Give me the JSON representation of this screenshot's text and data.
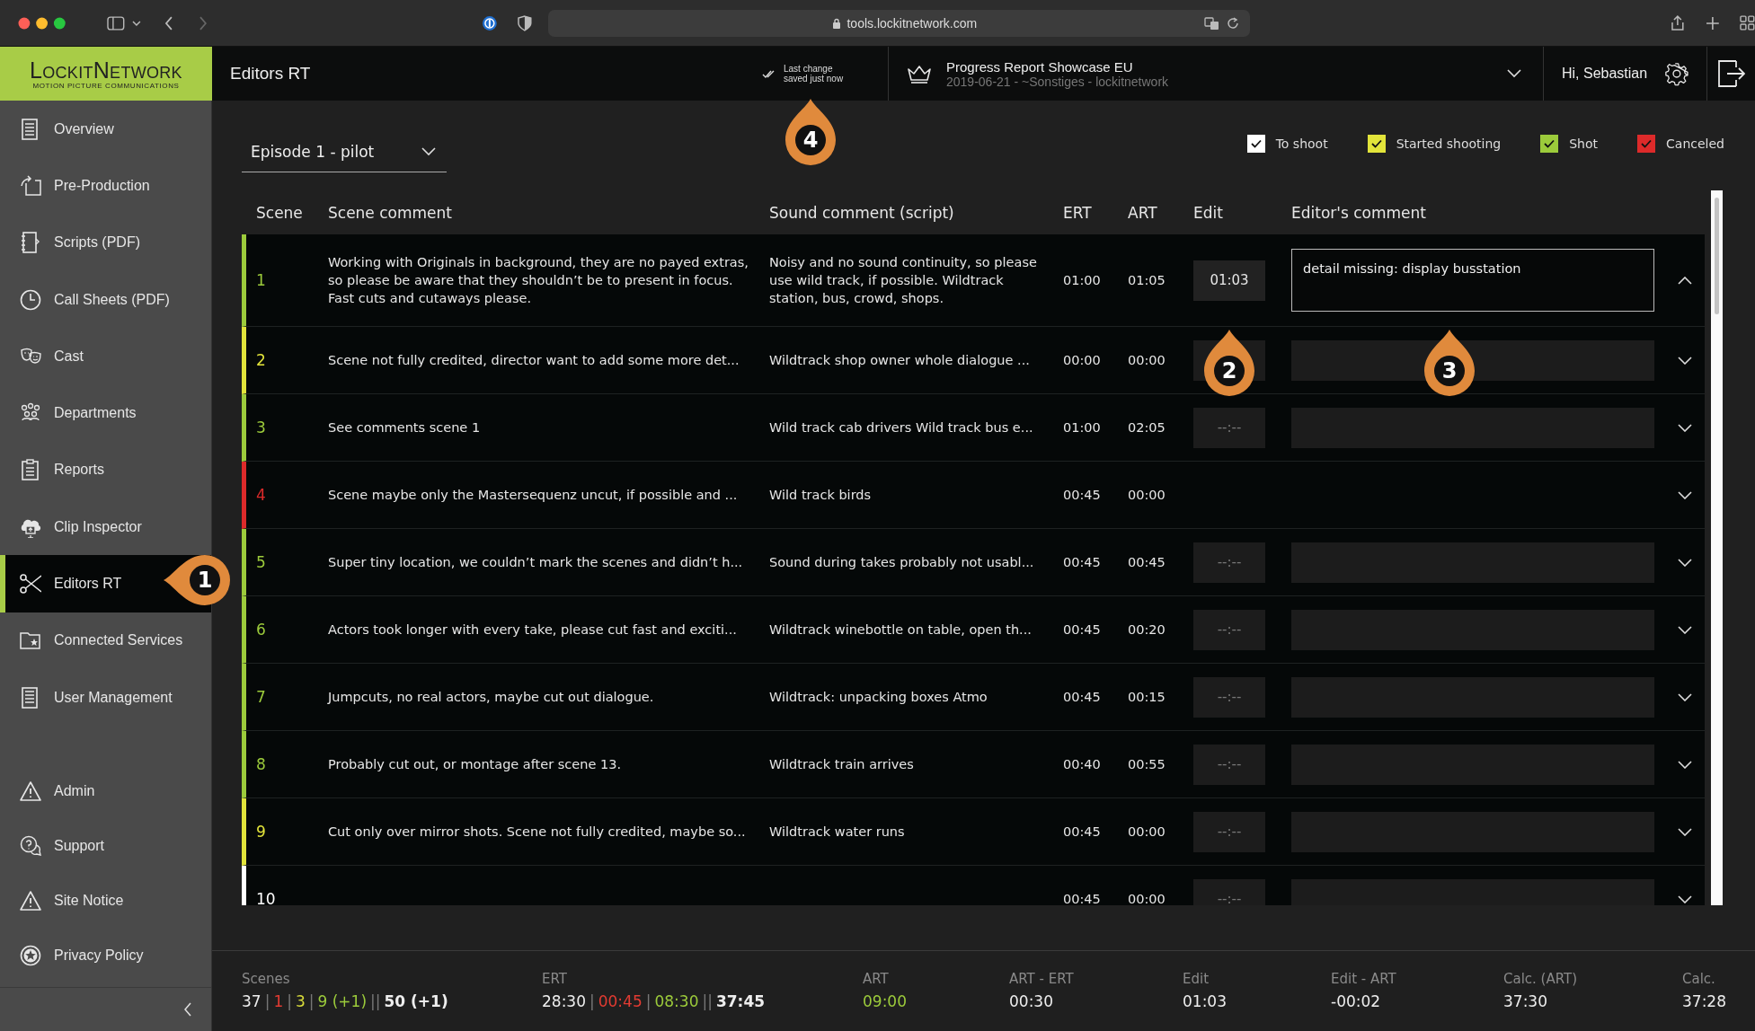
{
  "browser": {
    "url": "tools.lockitnetwork.com"
  },
  "logo": {
    "name": "LockitNetwork",
    "tagline": "MOTION PICTURE COMMUNICATIONS"
  },
  "header": {
    "title": "Editors RT",
    "save_status": [
      "Last change",
      "saved just now"
    ],
    "project": {
      "title": "Progress Report Showcase EU",
      "subtitle": "2019-06-21 - ~Sonstiges - lockitnetwork"
    },
    "greeting": "Hi, Sebastian"
  },
  "sidebar": {
    "items": [
      {
        "label": "Overview",
        "selected": false
      },
      {
        "label": "Pre-Production",
        "selected": false
      },
      {
        "label": "Scripts (PDF)",
        "selected": false
      },
      {
        "label": "Call Sheets (PDF)",
        "selected": false
      },
      {
        "label": "Cast",
        "selected": false
      },
      {
        "label": "Departments",
        "selected": false
      },
      {
        "label": "Reports",
        "selected": false
      },
      {
        "label": "Clip Inspector",
        "selected": false
      },
      {
        "label": "Editors RT",
        "selected": true
      },
      {
        "label": "Connected Services",
        "selected": false
      },
      {
        "label": "User Management",
        "selected": false
      }
    ],
    "footer_items": [
      {
        "label": "Admin",
        "selected": false
      },
      {
        "label": "Support",
        "selected": false
      },
      {
        "label": "Site Notice",
        "selected": false
      },
      {
        "label": "Privacy Policy",
        "selected": false
      }
    ]
  },
  "episode_select": {
    "value": "Episode 1 - pilot"
  },
  "legend": [
    {
      "label": "To shoot",
      "checked": true,
      "color": "#ffffff"
    },
    {
      "label": "Started shooting",
      "checked": true,
      "color": "#e2e43a"
    },
    {
      "label": "Shot",
      "checked": true,
      "color": "#9ccb3b"
    },
    {
      "label": "Canceled",
      "checked": true,
      "color": "#dd2a2a"
    }
  ],
  "table": {
    "columns": [
      "Scene",
      "Scene comment",
      "Sound comment (script)",
      "ERT",
      "ART",
      "Edit",
      "Editor's comment"
    ],
    "rows": [
      {
        "scene": "1",
        "color": "#9ccb3b",
        "scene_comment": "Working with Originals in background, they are no payed extras, so please be aware that they shouldn’t be to present in focus. Fast cuts and cutaways please.",
        "sound_comment": "Noisy and no sound continuity, so please use wild track, if possible. Wildtrack station, bus, crowd, shops.",
        "ert": "01:00",
        "art": "01:05",
        "edit": {
          "value": "01:03"
        },
        "editor_comment": {
          "value": "detail missing: display busstation",
          "focused": true
        },
        "expanded": true
      },
      {
        "scene": "2",
        "color": "#e2e43a",
        "scene_comment": "Scene not fully credited, director want to add some more det...",
        "sound_comment": "Wildtrack shop owner whole dialogue ...",
        "ert": "00:00",
        "art": "00:00",
        "edit": {},
        "editor_comment": {
          "focused": false
        },
        "expanded": false
      },
      {
        "scene": "3",
        "color": "#9ccb3b",
        "scene_comment": "See comments scene 1",
        "sound_comment": "Wild track cab drivers Wild track bus e...",
        "ert": "01:00",
        "art": "02:05",
        "edit": {
          "placeholder": "--:--"
        },
        "editor_comment": {
          "focused": false
        },
        "expanded": false
      },
      {
        "scene": "4",
        "color": "#dd2a2a",
        "scene_comment": "Scene maybe only the Mastersequenz uncut, if possible and ...",
        "sound_comment": "Wild track birds",
        "ert": "00:45",
        "art": "00:00",
        "expanded": false
      },
      {
        "scene": "5",
        "color": "#9ccb3b",
        "scene_comment": "Super tiny location, we couldn’t mark the scenes and didn’t h...",
        "sound_comment": "Sound during takes probably not usabl...",
        "ert": "00:45",
        "art": "00:45",
        "edit": {
          "placeholder": "--:--"
        },
        "editor_comment": {
          "focused": false
        },
        "expanded": false
      },
      {
        "scene": "6",
        "color": "#9ccb3b",
        "scene_comment": "Actors took longer with every take, please cut fast and exciti...",
        "sound_comment": "Wildtrack winebottle on table, open th...",
        "ert": "00:45",
        "art": "00:20",
        "edit": {
          "placeholder": "--:--"
        },
        "editor_comment": {
          "focused": false
        },
        "expanded": false
      },
      {
        "scene": "7",
        "color": "#9ccb3b",
        "scene_comment": "Jumpcuts, no real actors, maybe cut out dialogue.",
        "sound_comment": "Wildtrack: unpacking boxes Atmo",
        "ert": "00:45",
        "art": "00:15",
        "edit": {
          "placeholder": "--:--"
        },
        "editor_comment": {
          "focused": false
        },
        "expanded": false
      },
      {
        "scene": "8",
        "color": "#9ccb3b",
        "scene_comment": "Probably cut out, or montage after scene 13.",
        "sound_comment": "Wildtrack train arrives",
        "ert": "00:40",
        "art": "00:55",
        "edit": {
          "placeholder": "--:--"
        },
        "editor_comment": {
          "focused": false
        },
        "expanded": false
      },
      {
        "scene": "9",
        "color": "#e2e43a",
        "scene_comment": "Cut only over mirror shots. Scene not fully credited, maybe so...",
        "sound_comment": "Wildtrack water runs",
        "ert": "00:45",
        "art": "00:00",
        "edit": {
          "placeholder": "--:--"
        },
        "editor_comment": {
          "focused": false
        },
        "expanded": false
      },
      {
        "scene": "10",
        "color": "#ffffff",
        "ert": "00:45",
        "art": "00:00",
        "edit": {
          "placeholder": "--:--"
        },
        "editor_comment": {
          "focused": false
        },
        "expanded": false
      }
    ]
  },
  "summary": [
    {
      "label": "Scenes",
      "parts": [
        {
          "text": "37",
          "kind": "plain"
        },
        {
          "text": "|",
          "kind": "sep"
        },
        {
          "text": "1",
          "kind": "red"
        },
        {
          "text": "|",
          "kind": "sep"
        },
        {
          "text": "3",
          "kind": "yellow"
        },
        {
          "text": "|",
          "kind": "sep"
        },
        {
          "text": "9 (+1)",
          "kind": "green"
        },
        {
          "text": "||",
          "kind": "sep"
        },
        {
          "text": "50 (+1)",
          "kind": "bold"
        }
      ]
    },
    {
      "label": "ERT",
      "parts": [
        {
          "text": "28:30",
          "kind": "plain"
        },
        {
          "text": "|",
          "kind": "sep"
        },
        {
          "text": "00:45",
          "kind": "red"
        },
        {
          "text": "|",
          "kind": "sep"
        },
        {
          "text": "08:30",
          "kind": "green"
        },
        {
          "text": "||",
          "kind": "sep"
        },
        {
          "text": "37:45",
          "kind": "bold"
        }
      ]
    },
    {
      "label": "ART",
      "parts": [
        {
          "text": "09:00",
          "kind": "green"
        }
      ]
    },
    {
      "label": "ART - ERT",
      "parts": [
        {
          "text": "00:30",
          "kind": "plain"
        }
      ]
    },
    {
      "label": "Edit",
      "parts": [
        {
          "text": "01:03",
          "kind": "plain"
        }
      ]
    },
    {
      "label": "Edit - ART",
      "parts": [
        {
          "text": "-00:02",
          "kind": "plain"
        }
      ]
    },
    {
      "label": "Calc. (ART)",
      "parts": [
        {
          "text": "37:30",
          "kind": "plain"
        }
      ]
    },
    {
      "label": "Calc.",
      "parts": [
        {
          "text": "37:28",
          "kind": "plain"
        }
      ]
    }
  ],
  "callouts": [
    {
      "number": "1",
      "kind": "left"
    },
    {
      "number": "2",
      "kind": "up"
    },
    {
      "number": "3",
      "kind": "up"
    },
    {
      "number": "4",
      "kind": "up"
    }
  ]
}
